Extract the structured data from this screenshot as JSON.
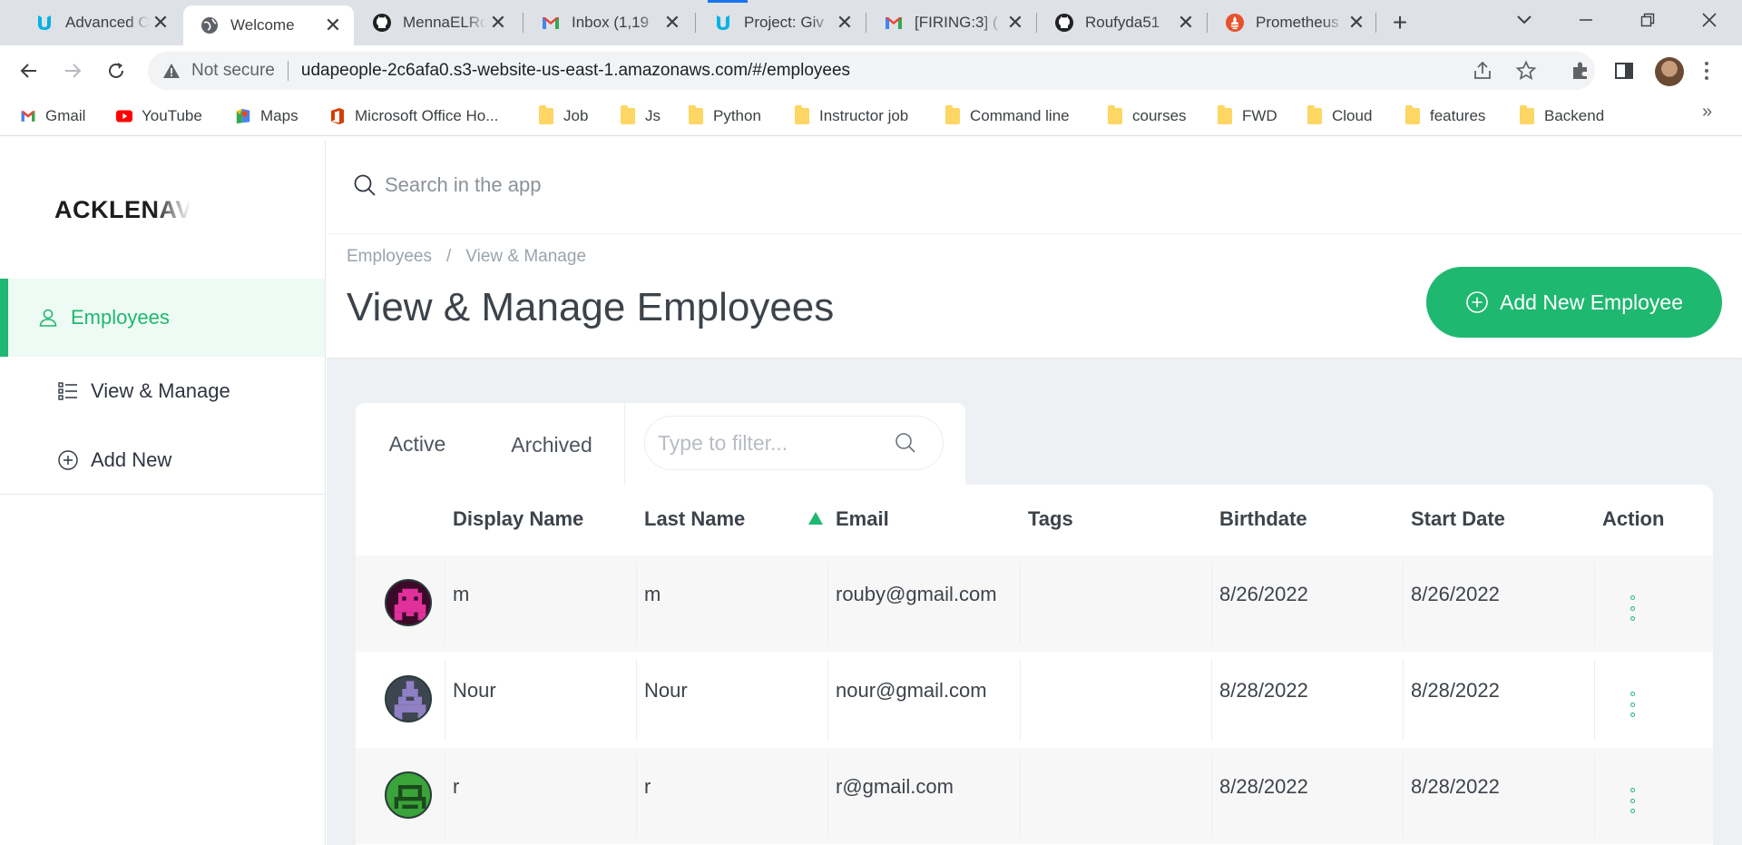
{
  "browser": {
    "tabs": [
      {
        "title": "Advanced C",
        "icon": "udacity-icon"
      },
      {
        "title": "Welcome",
        "icon": "globe-icon",
        "active": true
      },
      {
        "title": "MennaELRo",
        "icon": "github-icon"
      },
      {
        "title": "Inbox (1,19",
        "icon": "gmail-icon"
      },
      {
        "title": "Project: Giv",
        "icon": "udacity-icon"
      },
      {
        "title": "[FIRING:3] (",
        "icon": "gmail-icon"
      },
      {
        "title": "Roufyda51",
        "icon": "github-icon"
      },
      {
        "title": "Prometheus",
        "icon": "prometheus-icon"
      }
    ],
    "security_label": "Not secure",
    "url": "udapeople-2c6afa0.s3-website-us-east-1.amazonaws.com/#/employees",
    "bookmarks": [
      {
        "label": "Gmail",
        "icon": "gmail-icon"
      },
      {
        "label": "YouTube",
        "icon": "youtube-icon"
      },
      {
        "label": "Maps",
        "icon": "maps-icon"
      },
      {
        "label": "Microsoft Office Ho...",
        "icon": "office-icon"
      },
      {
        "label": "Job",
        "icon": "folder-icon"
      },
      {
        "label": "Js",
        "icon": "folder-icon"
      },
      {
        "label": "Python",
        "icon": "folder-icon"
      },
      {
        "label": "Instructor job",
        "icon": "folder-icon"
      },
      {
        "label": "Command line",
        "icon": "folder-icon"
      },
      {
        "label": "courses",
        "icon": "folder-icon"
      },
      {
        "label": "FWD",
        "icon": "folder-icon"
      },
      {
        "label": "Cloud",
        "icon": "folder-icon"
      },
      {
        "label": "features",
        "icon": "folder-icon"
      },
      {
        "label": "Backend",
        "icon": "folder-icon"
      }
    ]
  },
  "app": {
    "logo_text": "ACKLENAV",
    "accent_color": "#1fb870",
    "sidebar": {
      "items": [
        {
          "label": "Employees",
          "icon": "user-icon",
          "active": true
        },
        {
          "label": "View & Manage",
          "icon": "list-icon"
        },
        {
          "label": "Add New",
          "icon": "plus-circle-icon"
        }
      ]
    },
    "search": {
      "placeholder": "Search in the app"
    },
    "breadcrumb": {
      "root": "Employees",
      "separator": "/",
      "current": "View & Manage"
    },
    "page_title": "View & Manage Employees",
    "add_button_label": "Add New Employee",
    "tabs": {
      "active": "Active",
      "archived": "Archived"
    },
    "filter": {
      "placeholder": "Type to filter..."
    },
    "table": {
      "columns": [
        "Display Name",
        "Last Name",
        "Email",
        "Tags",
        "Birthdate",
        "Start Date",
        "Action"
      ],
      "sorted_column": "Email",
      "rows": [
        {
          "display_name": "m",
          "last_name": "m",
          "email": "rouby@gmail.com",
          "tags": "",
          "birthdate": "8/26/2022",
          "start_date": "8/26/2022",
          "avatar_color": "#e0309a"
        },
        {
          "display_name": "Nour",
          "last_name": "Nour",
          "email": "nour@gmail.com",
          "tags": "",
          "birthdate": "8/28/2022",
          "start_date": "8/28/2022",
          "avatar_color": "#8f7fc4"
        },
        {
          "display_name": "r",
          "last_name": "r",
          "email": "r@gmail.com",
          "tags": "",
          "birthdate": "8/28/2022",
          "start_date": "8/28/2022",
          "avatar_color": "#3aa33a"
        }
      ]
    }
  }
}
